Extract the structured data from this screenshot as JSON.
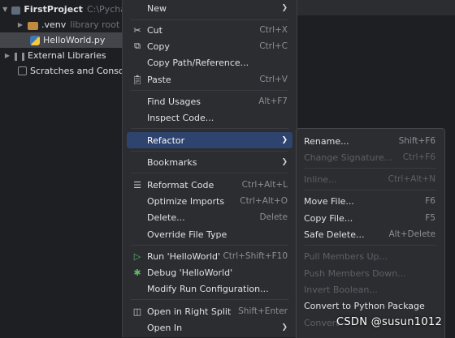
{
  "project_tree": {
    "root": {
      "name": "FirstProject",
      "path": "C:\\Pycharm"
    },
    "venv": {
      "name": ".venv",
      "note": "library root"
    },
    "file": {
      "name": "HelloWorld.py"
    },
    "external": {
      "name": "External Libraries"
    },
    "scratches": {
      "name": "Scratches and Consoles"
    }
  },
  "context_menu": {
    "new": "New",
    "cut": "Cut",
    "cut_sc": "Ctrl+X",
    "copy": "Copy",
    "copy_sc": "Ctrl+C",
    "copy_path": "Copy Path/Reference...",
    "paste": "Paste",
    "paste_sc": "Ctrl+V",
    "find_usages": "Find Usages",
    "find_usages_sc": "Alt+F7",
    "inspect_code": "Inspect Code...",
    "refactor": "Refactor",
    "bookmarks": "Bookmarks",
    "reformat": "Reformat Code",
    "reformat_sc": "Ctrl+Alt+L",
    "optimize": "Optimize Imports",
    "optimize_sc": "Ctrl+Alt+O",
    "delete": "Delete...",
    "delete_sc": "Delete",
    "override": "Override File Type",
    "run": "Run 'HelloWorld'",
    "run_sc": "Ctrl+Shift+F10",
    "debug": "Debug 'HelloWorld'",
    "modify_run": "Modify Run Configuration...",
    "open_split": "Open in Right Split",
    "open_split_sc": "Shift+Enter",
    "open_in": "Open In"
  },
  "refactor_submenu": {
    "rename": "Rename...",
    "rename_sc": "Shift+F6",
    "change_sig": "Change Signature...",
    "change_sig_sc": "Ctrl+F6",
    "inline": "Inline...",
    "inline_sc": "Ctrl+Alt+N",
    "move": "Move File...",
    "move_sc": "F6",
    "copy_file": "Copy File...",
    "copy_file_sc": "F5",
    "safe_delete": "Safe Delete...",
    "safe_delete_sc": "Alt+Delete",
    "pull_up": "Pull Members Up...",
    "push_down": "Push Members Down...",
    "invert_bool": "Invert Boolean...",
    "convert_pkg": "Convert to Python Package",
    "convert_last": "Convert"
  },
  "watermark": "CSDN @susun1012",
  "colors": {
    "background": "#1e1f22",
    "menu": "#2b2d30",
    "highlight": "#2e436e",
    "selection": "#43454a"
  }
}
